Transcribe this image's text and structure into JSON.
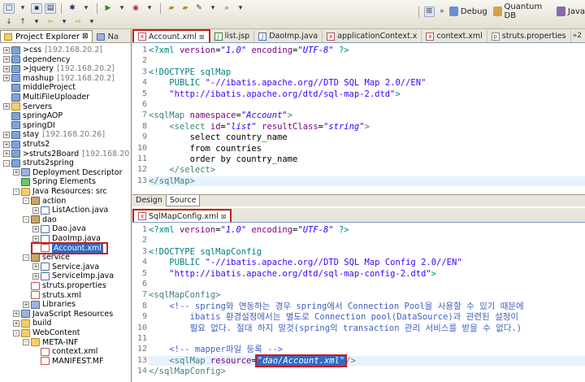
{
  "toolbar": {
    "perspectives": [
      {
        "label": "Debug",
        "icon": "debug-icon"
      },
      {
        "label": "Quantum DB",
        "icon": "database-icon"
      },
      {
        "label": "Java",
        "icon": "java-icon"
      }
    ]
  },
  "explorer": {
    "tabs": [
      {
        "label": "Project Explorer",
        "close": "⊠"
      },
      {
        "label": "Na"
      }
    ],
    "tree": [
      {
        "indent": 0,
        "tw": "+",
        "icon": "proj",
        "label": ">css",
        "sub": "[192.168.20.2]"
      },
      {
        "indent": 0,
        "tw": "+",
        "icon": "proj",
        "label": "dependency",
        "sub": ""
      },
      {
        "indent": 0,
        "tw": "+",
        "icon": "proj",
        "label": ">jquery",
        "sub": "[192.168.20.2]"
      },
      {
        "indent": 0,
        "tw": "+",
        "icon": "proj",
        "label": "mashup",
        "sub": "[192.168.20.2]"
      },
      {
        "indent": 0,
        "tw": "",
        "icon": "proj",
        "label": "middleProject",
        "sub": ""
      },
      {
        "indent": 0,
        "tw": "",
        "icon": "proj",
        "label": "MultiFileUploader",
        "sub": ""
      },
      {
        "indent": 0,
        "tw": "+",
        "icon": "fold",
        "label": "Servers",
        "sub": ""
      },
      {
        "indent": 0,
        "tw": "",
        "icon": "proj",
        "label": "springAOP",
        "sub": ""
      },
      {
        "indent": 0,
        "tw": "",
        "icon": "proj",
        "label": "springDI",
        "sub": ""
      },
      {
        "indent": 0,
        "tw": "+",
        "icon": "proj",
        "label": "stay",
        "sub": "[192.168.20.26]"
      },
      {
        "indent": 0,
        "tw": "+",
        "icon": "proj",
        "label": "struts2",
        "sub": ""
      },
      {
        "indent": 0,
        "tw": "+",
        "icon": "proj",
        "label": ">struts2Board",
        "sub": "[192.168.20"
      },
      {
        "indent": 0,
        "tw": "-",
        "icon": "proj",
        "label": "struts2spring",
        "sub": ""
      },
      {
        "indent": 1,
        "tw": "+",
        "icon": "lib",
        "label": "Deployment Descriptor",
        "sub": ""
      },
      {
        "indent": 1,
        "tw": "",
        "icon": "green",
        "label": "Spring Elements",
        "sub": ""
      },
      {
        "indent": 1,
        "tw": "-",
        "icon": "fold",
        "label": "Java Resources: src",
        "sub": ""
      },
      {
        "indent": 2,
        "tw": "-",
        "icon": "pkg",
        "label": "action",
        "sub": ""
      },
      {
        "indent": 3,
        "tw": "+",
        "icon": "java",
        "label": "ListAction.java",
        "sub": ""
      },
      {
        "indent": 2,
        "tw": "-",
        "icon": "pkg",
        "label": "dao",
        "sub": ""
      },
      {
        "indent": 3,
        "tw": "+",
        "icon": "java",
        "label": "Dao.java",
        "sub": ""
      },
      {
        "indent": 3,
        "tw": "+",
        "icon": "java",
        "label": "DaoImp.java",
        "sub": ""
      },
      {
        "indent": 3,
        "tw": "",
        "icon": "xml",
        "label": "Account.xml",
        "sub": "",
        "selected": true
      },
      {
        "indent": 2,
        "tw": "-",
        "icon": "pkg",
        "label": "service",
        "sub": ""
      },
      {
        "indent": 3,
        "tw": "+",
        "icon": "java",
        "label": "Service.java",
        "sub": ""
      },
      {
        "indent": 3,
        "tw": "+",
        "icon": "java",
        "label": "ServiceImp.java",
        "sub": ""
      },
      {
        "indent": 2,
        "tw": "",
        "icon": "xml",
        "label": "struts.properties",
        "sub": ""
      },
      {
        "indent": 2,
        "tw": "",
        "icon": "xml",
        "label": "struts.xml",
        "sub": ""
      },
      {
        "indent": 2,
        "tw": "+",
        "icon": "lib",
        "label": "Libraries",
        "sub": ""
      },
      {
        "indent": 1,
        "tw": "+",
        "icon": "lib",
        "label": "JavaScript Resources",
        "sub": ""
      },
      {
        "indent": 1,
        "tw": "+",
        "icon": "fold",
        "label": "build",
        "sub": ""
      },
      {
        "indent": 1,
        "tw": "-",
        "icon": "fold",
        "label": "WebContent",
        "sub": ""
      },
      {
        "indent": 2,
        "tw": "-",
        "icon": "fold",
        "label": "META-INF",
        "sub": ""
      },
      {
        "indent": 3,
        "tw": "",
        "icon": "xml",
        "label": "context.xml",
        "sub": ""
      },
      {
        "indent": 3,
        "tw": "",
        "icon": "xml",
        "label": "MANIFEST.MF",
        "sub": ""
      }
    ]
  },
  "editor1": {
    "tabs": [
      {
        "label": "Account.xml",
        "icon": "x",
        "active": true,
        "close": "⊠"
      },
      {
        "label": "list.jsp",
        "icon": "j"
      },
      {
        "label": "DaoImp.java",
        "icon": "J"
      },
      {
        "label": "applicationContext.x",
        "icon": "x"
      },
      {
        "label": "context.xml",
        "icon": "x"
      },
      {
        "label": "struts.properties",
        "icon": "p"
      }
    ],
    "more": "»2",
    "lines": [
      {
        "n": "1",
        "segs": [
          [
            "pi",
            "<?xml "
          ],
          [
            "attr",
            "version"
          ],
          [
            "",
            "="
          ],
          [
            "val",
            "\"1.0\""
          ],
          [
            "",
            ""
          ],
          [
            "attr",
            " encoding"
          ],
          [
            "",
            "="
          ],
          [
            "val",
            "\"UTF-8\""
          ],
          [
            "pi",
            " ?>"
          ]
        ]
      },
      {
        "n": "2",
        "segs": []
      },
      {
        "n": "3",
        "segs": [
          [
            "doc",
            "<!DOCTYPE sqlMap"
          ]
        ]
      },
      {
        "n": "4",
        "segs": [
          [
            "",
            "    "
          ],
          [
            "doc",
            "PUBLIC "
          ],
          [
            "str",
            "\"-//ibatis.apache.org//DTD SQL Map 2.0//EN\""
          ]
        ]
      },
      {
        "n": "5",
        "segs": [
          [
            "",
            "    "
          ],
          [
            "str",
            "\"http://ibatis.apache.org/dtd/sql-map-2.dtd\""
          ],
          [
            "doc",
            ">"
          ]
        ]
      },
      {
        "n": "6",
        "segs": []
      },
      {
        "n": "7",
        "segs": [
          [
            "tag",
            "<sqlMap "
          ],
          [
            "attr",
            "namespace"
          ],
          [
            "",
            "="
          ],
          [
            "val",
            "\"Account\""
          ],
          [
            "tag",
            ">"
          ]
        ]
      },
      {
        "n": "8",
        "segs": [
          [
            "",
            "    "
          ],
          [
            "tag",
            "<select "
          ],
          [
            "attr",
            "id"
          ],
          [
            "",
            "="
          ],
          [
            "val",
            "\"list\""
          ],
          [
            "attr",
            " resultClass"
          ],
          [
            "",
            "="
          ],
          [
            "val",
            "\"string\""
          ],
          [
            "tag",
            ">"
          ]
        ]
      },
      {
        "n": "9",
        "segs": [
          [
            "",
            "        select country_name"
          ]
        ]
      },
      {
        "n": "10",
        "segs": [
          [
            "",
            "        from countries"
          ]
        ]
      },
      {
        "n": "11",
        "segs": [
          [
            "",
            "        order by country_name"
          ]
        ]
      },
      {
        "n": "12",
        "segs": [
          [
            "",
            "    "
          ],
          [
            "tag",
            "</select>"
          ]
        ]
      },
      {
        "n": "13",
        "segs": [
          [
            "tag",
            "</sqlMap>"
          ]
        ],
        "highlight": true
      }
    ],
    "bottom_tabs": [
      "Design",
      "Source"
    ]
  },
  "editor2": {
    "tabs": [
      {
        "label": "SqlMapConfig.xml",
        "icon": "x",
        "active": true,
        "close": "⊠"
      }
    ],
    "lines": [
      {
        "n": "1",
        "segs": [
          [
            "pi",
            "<?xml "
          ],
          [
            "attr",
            "version"
          ],
          [
            "",
            "="
          ],
          [
            "val",
            "\"1.0\""
          ],
          [
            "attr",
            " encoding"
          ],
          [
            "",
            "="
          ],
          [
            "val",
            "\"UTF-8\""
          ],
          [
            "pi",
            " ?>"
          ]
        ]
      },
      {
        "n": "2",
        "segs": []
      },
      {
        "n": "3",
        "segs": [
          [
            "doc",
            "<!DOCTYPE sqlMapConfig"
          ]
        ]
      },
      {
        "n": "4",
        "segs": [
          [
            "",
            "    "
          ],
          [
            "doc",
            "PUBLIC "
          ],
          [
            "str",
            "\"-//ibatis.apache.org//DTD SQL Map Config 2.0//EN\""
          ]
        ]
      },
      {
        "n": "5",
        "segs": [
          [
            "",
            "    "
          ],
          [
            "str",
            "\"http://ibatis.apache.org/dtd/sql-map-config-2.dtd\""
          ],
          [
            "doc",
            ">"
          ]
        ]
      },
      {
        "n": "6",
        "segs": []
      },
      {
        "n": "7",
        "segs": [
          [
            "tag",
            "<sqlMapConfig>"
          ]
        ]
      },
      {
        "n": "8",
        "segs": [
          [
            "",
            "    "
          ],
          [
            "cmt",
            "<!-- spring와 연동하는 경우 spring에서 Connection Pool을 사용할 수 있기 때문에"
          ]
        ]
      },
      {
        "n": "9",
        "segs": [
          [
            "cmt",
            "        ibatis 환경설정에서는 별도로 Connection pool(DataSource)과 관련된 설정이"
          ]
        ]
      },
      {
        "n": "10",
        "segs": [
          [
            "cmt",
            "        필요 없다. 절대 하지 말것(spring의 transaction 관리 서비스를 받을 수 없다.)"
          ]
        ]
      },
      {
        "n": "11",
        "segs": []
      },
      {
        "n": "12",
        "segs": [
          [
            "",
            "    "
          ],
          [
            "cmt",
            "<!-- mapper파일 등록 -->"
          ]
        ]
      },
      {
        "n": "13",
        "segs": [
          [
            "",
            "    "
          ],
          [
            "tag",
            "<sqlMap "
          ],
          [
            "attr",
            "resource"
          ],
          [
            "",
            "="
          ],
          [
            "res",
            "\"dao/Account.xml\""
          ],
          [
            "tag",
            "/>"
          ]
        ],
        "highlight": true
      },
      {
        "n": "14",
        "segs": [
          [
            "tag",
            "</sqlMapConfig>"
          ]
        ]
      }
    ]
  }
}
